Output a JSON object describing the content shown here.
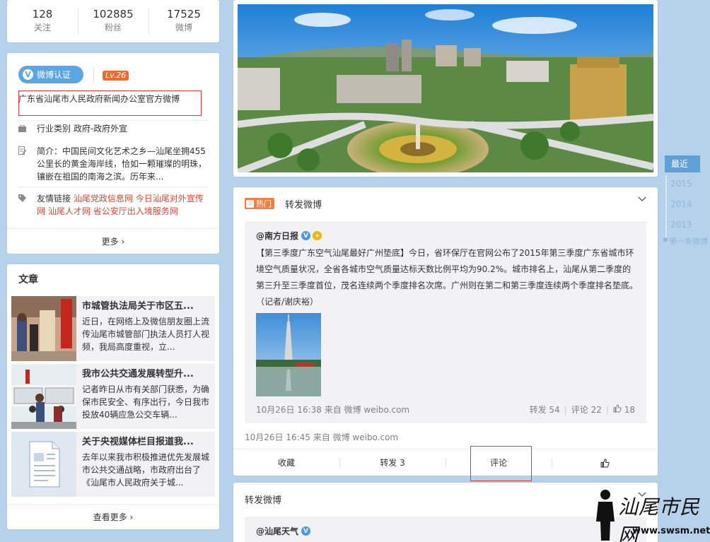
{
  "stats": [
    {
      "num": "128",
      "label": "关注"
    },
    {
      "num": "102885",
      "label": "粉丝"
    },
    {
      "num": "17525",
      "label": "微博"
    }
  ],
  "profile": {
    "verify_label": "微博认证",
    "verify_mark": "V",
    "level": "Lv.26",
    "verify_desc": "广东省汕尾市人民政府新闻办公室官方微博",
    "industry_label": "行业类别",
    "industry_value": "政府-政府外宣",
    "intro_label": "简介：",
    "intro": "中国民间文化艺术之乡—汕尾坐拥455公里长的黄金海岸线，恰如一颗璀璨的明珠，镶嵌在祖国的南海之滨。历年来...",
    "links_label": "友情链接",
    "links": [
      "汕尾党政信息网",
      "今日汕尾对外宣传网",
      "汕尾人才网",
      "省公安厅出入境服务网"
    ],
    "more": "更多"
  },
  "articles": {
    "title": "文章",
    "items": [
      {
        "title": "市城管执法局关于市区五...",
        "summary": "近日，在网络上及微信朋友圈上流传汕尾市城管部门执法人员打人视频，我局高度重视，立..."
      },
      {
        "title": "我市公共交通发展转型升...",
        "summary": "记者昨日从市有关部门获悉，为确保市民安全、有序出行，今日我市投放40辆应急公交车辆..."
      },
      {
        "title": "关于央视媒体栏目报道我...",
        "summary": "去年以来我市积极推进优先发展城市公共交通战略，市政府出台了《汕尾市人民政府关于城..."
      }
    ],
    "see_more": "查看更多"
  },
  "post1": {
    "hot_label": "热门",
    "header": "转发微博",
    "orig_author": "@南方日报",
    "orig_text": "【第三季度广东空气汕尾最好广州垫底】今日，省环保厅在官网公布了2015年第三季度广东省城市环境空气质量状况，全省各城市空气质量达标天数比例平均为90.2%。城市排名上，汕尾从第二季度的第三升至三季度首位，茂名连续两个季度排名次席。广州则在第二和第三季度连续两个季度排名垫底。（记者/谢庆裕）",
    "orig_time": "10月26日 16:38 来自 微博 weibo.com",
    "orig_repost": "转发 54",
    "orig_comment": "评论 22",
    "orig_like": "18",
    "time": "10月26日 16:45 来自 微博 weibo.com",
    "actions": {
      "collect": "收藏",
      "repost": "转发 3",
      "comment": "评论"
    }
  },
  "post2": {
    "header": "转发微博",
    "orig_author": "@汕尾天气"
  },
  "timeline": {
    "active": "最近",
    "years": [
      "2015",
      "2014",
      "2013"
    ],
    "first": "第一条微博"
  },
  "watermark": {
    "text": "汕尾市民网",
    "url": "www.swsm.net"
  }
}
